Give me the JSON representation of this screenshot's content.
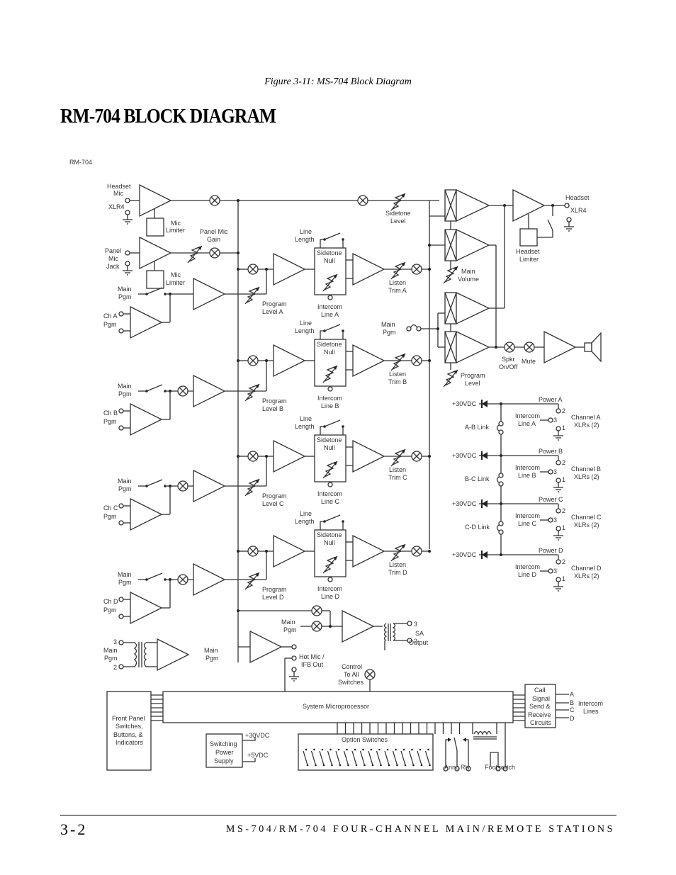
{
  "figure_caption": "Figure 3-11: MS-704 Block Diagram",
  "section_title": "RM-704 BLOCK DIAGRAM",
  "diagram": {
    "label": "RM-704",
    "inputs": {
      "headset_mic": [
        "Headset",
        "Mic"
      ],
      "xlr4_in": "XLR4",
      "mic_limiter": [
        "Mic",
        "Limiter"
      ],
      "panel_mic_gain": [
        "Panel Mic",
        "Gain"
      ],
      "panel_mic_jack": [
        "Panel",
        "Mic",
        "Jack"
      ],
      "main_pgm": [
        "Main",
        "Pgm"
      ]
    },
    "channels": [
      {
        "id": "A",
        "ch_pgm": [
          "Ch A",
          "Pgm"
        ],
        "program_level": [
          "Program",
          "Level A"
        ],
        "line_length": [
          "Line",
          "Length"
        ],
        "sidetone_null": [
          "Sidetone",
          "Null"
        ],
        "intercom_line": [
          "Intercom",
          "Line A"
        ],
        "listen_trim": [
          "Listen",
          "Trim A"
        ]
      },
      {
        "id": "B",
        "ch_pgm": [
          "Ch B",
          "Pgm"
        ],
        "program_level": [
          "Program",
          "Level B"
        ],
        "line_length": [
          "Line",
          "Length"
        ],
        "sidetone_null": [
          "Sidetone",
          "Null"
        ],
        "intercom_line": [
          "Intercom",
          "Line B"
        ],
        "listen_trim": [
          "Listen",
          "Trim B"
        ]
      },
      {
        "id": "C",
        "ch_pgm": [
          "Ch C",
          "Pgm"
        ],
        "program_level": [
          "Program",
          "Level C"
        ],
        "line_length": [
          "Line",
          "Length"
        ],
        "sidetone_null": [
          "Sidetone",
          "Null"
        ],
        "intercom_line": [
          "Intercom",
          "Line C"
        ],
        "listen_trim": [
          "Listen",
          "Trim C"
        ]
      },
      {
        "id": "D",
        "ch_pgm": [
          "Ch D",
          "Pgm"
        ],
        "program_level": [
          "Program",
          "Level D"
        ],
        "line_length": [
          "Line",
          "Length"
        ],
        "sidetone_null": [
          "Sidetone",
          "Null"
        ],
        "intercom_line": [
          "Intercom",
          "Line D"
        ],
        "listen_trim": [
          "Listen",
          "Trim D"
        ]
      }
    ],
    "outputs": {
      "sidetone_level": [
        "Sidetone",
        "Level"
      ],
      "headset_out": "Headset",
      "xlr4_out": "XLR4",
      "headset_limiter": [
        "Headset",
        "Limiter"
      ],
      "main_volume": [
        "Main",
        "Volume"
      ],
      "main_pgm": [
        "Main",
        "Pgm"
      ],
      "program_level": [
        "Program",
        "Level"
      ],
      "spkr_onoff": [
        "Spkr",
        "On/Off"
      ],
      "mute": "Mute"
    },
    "power": [
      {
        "supply": "+30VDC",
        "power": "Power A",
        "intercom": [
          "Intercom",
          "Line A"
        ],
        "xlrs": [
          "Channel A",
          "XLRs (2)"
        ],
        "link": "A-B Link"
      },
      {
        "supply": "+30VDC",
        "power": "Power B",
        "intercom": [
          "Intercom",
          "Line B"
        ],
        "xlrs": [
          "Channel B",
          "XLRs (2)"
        ],
        "link": "B-C Link"
      },
      {
        "supply": "+30VDC",
        "power": "Power C",
        "intercom": [
          "Intercom",
          "Line C"
        ],
        "xlrs": [
          "Channel C",
          "XLRs (2)"
        ],
        "link": "C-D Link"
      },
      {
        "supply": "+30VDC",
        "power": "Power D",
        "intercom": [
          "Intercom",
          "Line D"
        ],
        "xlrs": [
          "Channel D",
          "XLRs (2)"
        ],
        "link": ""
      }
    ],
    "pins": {
      "p1": "1",
      "p2": "2",
      "p3": "3"
    },
    "bottom": {
      "main_pgm_in": [
        "Main",
        "Pgm"
      ],
      "main_pgm_out": [
        "Main",
        "Pgm"
      ],
      "sa_main_pgm": [
        "Main",
        "Pgm"
      ],
      "sa_output": [
        "SA",
        "Output"
      ],
      "hot_mic": [
        "Hot Mic /",
        "IFB Out"
      ],
      "control_switches": [
        "Control",
        "To All",
        "Switches"
      ],
      "system_micro": "System Microprocessor",
      "front_panel": [
        "Front Panel",
        "Switches,",
        "Buttons, &",
        "Indicators"
      ],
      "power_supply": [
        "Switching",
        "Power",
        "Supply"
      ],
      "v30": "+30VDC",
      "v5": "+5VDC",
      "option_switches": "Option Switches",
      "call_signal": [
        "Call",
        "Signal",
        "Send &",
        "Receive",
        "Circuits"
      ],
      "intercom_lines": [
        "Intercom",
        "Lines"
      ],
      "line_letters": [
        "A",
        "B",
        "C",
        "D"
      ],
      "annc_rly": "Annc Rly",
      "footswitch": "Footswitch"
    }
  },
  "footer": {
    "page_number": "3-2",
    "title": "MS-704/RM-704 FOUR-CHANNEL MAIN/REMOTE STATIONS"
  }
}
